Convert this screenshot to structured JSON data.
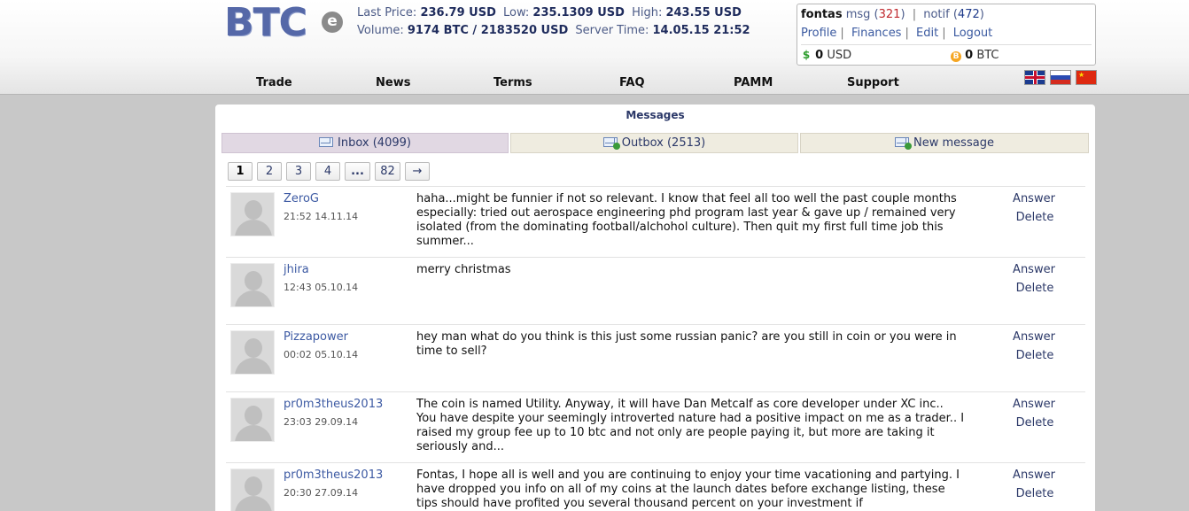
{
  "logo": {
    "text": "BTC",
    "badge": "e"
  },
  "ticker": {
    "last_price_label": "Last Price:",
    "last_price": "236.79 USD",
    "low_label": "Low:",
    "low": "235.1309 USD",
    "high_label": "High:",
    "high": "243.55 USD",
    "volume_label": "Volume:",
    "volume": "9174 BTC / 2183520 USD",
    "server_time_label": "Server Time:",
    "server_time": "14.05.15 21:52"
  },
  "user": {
    "name": "fontas",
    "msg_label": "msg",
    "msg_count": "321",
    "notif_label": "notif",
    "notif_count": "472",
    "links": [
      "Profile",
      "Finances",
      "Edit",
      "Logout"
    ],
    "usd_amount": "0",
    "usd_unit": "USD",
    "btc_amount": "0",
    "btc_unit": "BTC"
  },
  "nav": [
    "Trade",
    "News",
    "Terms",
    "FAQ",
    "PAMM",
    "Support"
  ],
  "panel_title": "Messages",
  "tabs": [
    {
      "label": "Inbox (4099)",
      "icon": "inbox-envelope-icon"
    },
    {
      "label": "Outbox (2513)",
      "icon": "outbox-envelope-icon"
    },
    {
      "label": "New message",
      "icon": "new-message-icon"
    }
  ],
  "pager": [
    "1",
    "2",
    "3",
    "4",
    "...",
    "82",
    "→"
  ],
  "actions": {
    "answer": "Answer",
    "delete": "Delete"
  },
  "messages": [
    {
      "user": "ZeroG",
      "time": "21:52 14.11.14",
      "text": "haha...might be funnier if not so relevant. I know that feel all too well the past couple months especially: tried out aerospace engineering phd program last year & gave up / remained very isolated (from the dominating football/alchohol culture). Then quit my first full time job this summer..."
    },
    {
      "user": "jhira",
      "time": "12:43 05.10.14",
      "text": "merry christmas"
    },
    {
      "user": "Pizzapower",
      "time": "00:02 05.10.14",
      "text": "hey man what do you think is this just some russian panic? are you still in coin or you were in time to sell?"
    },
    {
      "user": "pr0m3theus2013",
      "time": "23:03 29.09.14",
      "text": "The coin is named Utility. Anyway, it will have Dan Metcalf as core developer under XC inc.. You have despite your seemingly introverted nature had a positive impact on me as a trader.. I raised my group fee up to 10 btc and not only are people paying it, but more are taking it seriously and..."
    },
    {
      "user": "pr0m3theus2013",
      "time": "20:30 27.09.14",
      "text": "Fontas, I hope all is well and you are continuing to enjoy your time vacationing and partying. I have dropped you info on all of my coins at the launch dates before exchange listing, these tips should have profited you several thousand percent on your investment if"
    }
  ]
}
